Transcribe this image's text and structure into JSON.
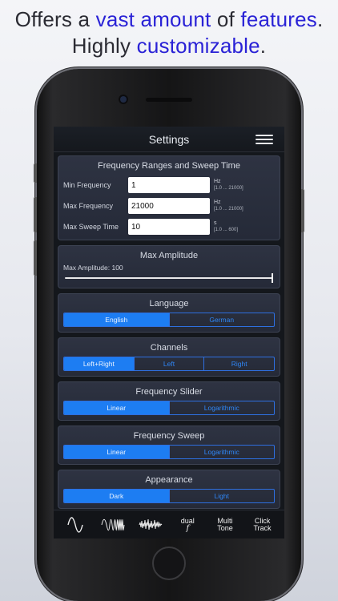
{
  "headline": {
    "line1": [
      {
        "text": "Offers a ",
        "hl": false
      },
      {
        "text": "vast amount",
        "hl": true
      },
      {
        "text": " of ",
        "hl": false
      },
      {
        "text": "features",
        "hl": true
      },
      {
        "text": ".",
        "hl": false
      }
    ],
    "line2": [
      {
        "text": "Highly ",
        "hl": false
      },
      {
        "text": "customizable",
        "hl": true
      },
      {
        "text": ".",
        "hl": false
      }
    ],
    "highlight_color": "#2a22d6"
  },
  "navbar": {
    "title": "Settings",
    "menu_icon": "hamburger-menu-icon"
  },
  "frequency": {
    "title": "Frequency Ranges and Sweep Time",
    "rows": [
      {
        "label": "Min Frequency",
        "value": "1",
        "unit": "Hz",
        "range": "[1.0 ... 21000]"
      },
      {
        "label": "Max Frequency",
        "value": "21000",
        "unit": "Hz",
        "range": "[1.0 ... 21000]"
      },
      {
        "label": "Max Sweep Time",
        "value": "10",
        "unit": "s",
        "range": "[1.0 ... 600]"
      }
    ]
  },
  "amplitude": {
    "title": "Max Amplitude",
    "label": "Max Amplitude: 100",
    "value": 100,
    "max": 100
  },
  "sections": [
    {
      "key": "language",
      "title": "Language",
      "options": [
        "English",
        "German"
      ],
      "selected": 0
    },
    {
      "key": "channels",
      "title": "Channels",
      "options": [
        "Left+Right",
        "Left",
        "Right"
      ],
      "selected": 0
    },
    {
      "key": "slider",
      "title": "Frequency Slider",
      "options": [
        "Linear",
        "Logarithmic"
      ],
      "selected": 0
    },
    {
      "key": "sweep",
      "title": "Frequency Sweep",
      "options": [
        "Linear",
        "Logarithmic"
      ],
      "selected": 0
    },
    {
      "key": "appearance",
      "title": "Appearance",
      "options": [
        "Dark",
        "Light"
      ],
      "selected": 0
    }
  ],
  "tabbar": {
    "tabs": [
      {
        "name": "tab-sine",
        "icon": "sine-wave-icon"
      },
      {
        "name": "tab-sweep",
        "icon": "sweep-wave-icon"
      },
      {
        "name": "tab-noise",
        "icon": "noise-wave-icon"
      },
      {
        "name": "tab-dual",
        "label1": "dual",
        "label2": "f"
      },
      {
        "name": "tab-multi-tone",
        "label1": "Multi",
        "label2": "Tone"
      },
      {
        "name": "tab-click-track",
        "label1": "Click",
        "label2": "Track"
      }
    ]
  },
  "colors": {
    "accent": "#1d7df2",
    "card": "#2b3040",
    "background": "#14171c"
  }
}
